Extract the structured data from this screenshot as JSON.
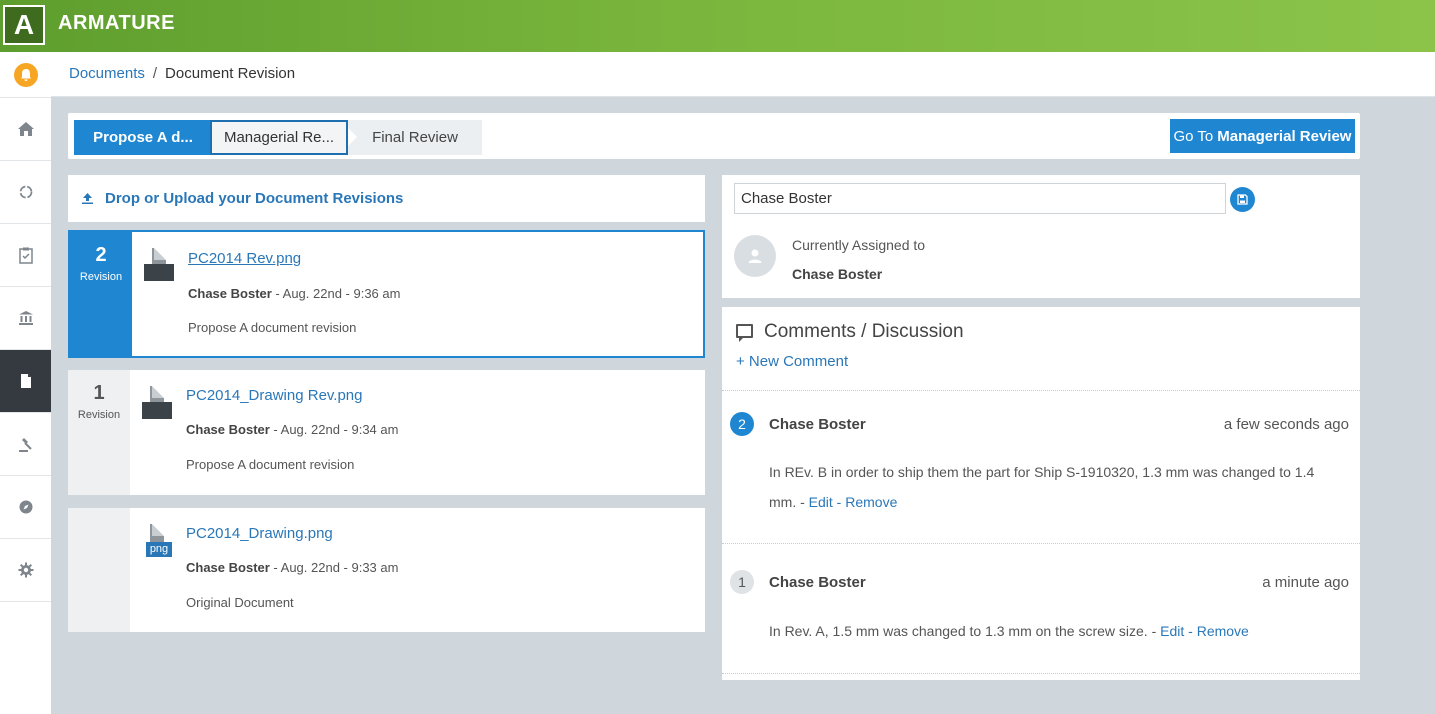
{
  "app": {
    "logo_letter": "A",
    "brand": "ARMATURE"
  },
  "sidebar": {
    "items": [
      {
        "icon": "bell-icon"
      },
      {
        "icon": "home-icon"
      },
      {
        "icon": "circle-icon"
      },
      {
        "icon": "clipboard-check-icon"
      },
      {
        "icon": "bank-icon"
      },
      {
        "icon": "document-icon"
      },
      {
        "icon": "gavel-icon"
      },
      {
        "icon": "compass-icon"
      },
      {
        "icon": "gear-icon"
      }
    ],
    "active_item": "document-icon"
  },
  "breadcrumb": {
    "root": "Documents",
    "separator": "/",
    "current": "Document Revision"
  },
  "workflow": {
    "steps": [
      "Propose A d...",
      "Managerial Re...",
      "Final Review"
    ],
    "goto_prefix": "Go To",
    "goto_target": "Managerial Review"
  },
  "upload": {
    "label": "Drop or Upload your Document Revisions"
  },
  "revisions": [
    {
      "number": "2",
      "label": "Revision",
      "file": "PC2014 Rev.png",
      "author": "Chase Boster",
      "meta": " - Aug. 22nd - 9:36 am",
      "description": "Propose A document revision"
    },
    {
      "number": "1",
      "label": "Revision",
      "file": "PC2014_Drawing Rev.png",
      "author": "Chase Boster",
      "meta": " - Aug. 22nd - 9:34 am",
      "description": "Propose A document revision"
    },
    {
      "number": "",
      "label": "",
      "file": "PC2014_Drawing.png",
      "file_badge": "png",
      "author": "Chase Boster",
      "meta": " - Aug. 22nd - 9:33 am",
      "description": "Original Document"
    }
  ],
  "assignment": {
    "input_value": "Chase Boster",
    "label": "Currently Assigned to",
    "name": "Chase Boster"
  },
  "comments": {
    "title": "Comments / Discussion",
    "new_comment": "+ New Comment",
    "items": [
      {
        "number": "2",
        "author": "Chase Boster",
        "time": "a few seconds ago",
        "text": "In REv. B in order to ship them the part for Ship S-1910320, 1.3 mm was changed to 1.4 mm. - ",
        "edit": "Edit",
        "sep": " - ",
        "remove": "Remove"
      },
      {
        "number": "1",
        "author": "Chase Boster",
        "time": "a minute ago",
        "text": "In Rev. A, 1.5 mm was changed to 1.3 mm on the screw size. - ",
        "edit": "Edit",
        "sep": " - ",
        "remove": "Remove"
      }
    ]
  },
  "colors": {
    "accent": "#1f86d1",
    "brand_green": "#79b53c",
    "sidebar_active": "#343a3f"
  }
}
